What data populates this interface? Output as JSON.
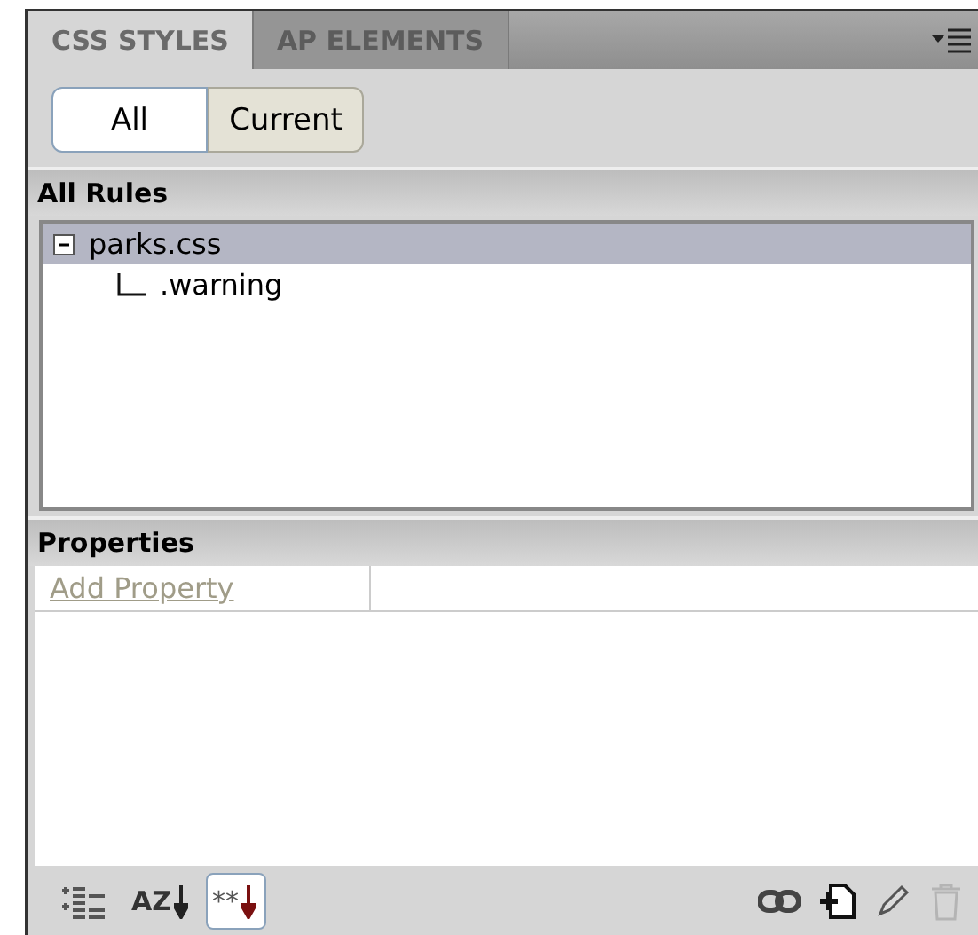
{
  "tabs": [
    {
      "label": "CSS STYLES",
      "selected": true
    },
    {
      "label": "AP ELEMENTS",
      "selected": false
    }
  ],
  "mode_toggle": [
    {
      "label": "All",
      "selected": true
    },
    {
      "label": "Current",
      "selected": false
    }
  ],
  "rules_section": {
    "title": "All Rules",
    "tree": [
      {
        "label": "parks.css",
        "expanded": true,
        "selected": true,
        "children": [
          {
            "label": ".warning",
            "selected": false
          }
        ]
      }
    ]
  },
  "properties_section": {
    "title": "Properties",
    "add_link": "Add Property"
  },
  "view_buttons": [
    {
      "kind": "category",
      "selected": false
    },
    {
      "kind": "alpha",
      "text": "AZ",
      "selected": false
    },
    {
      "kind": "set",
      "text": "**",
      "selected": true
    }
  ],
  "action_buttons": [
    {
      "kind": "attach",
      "disabled": false
    },
    {
      "kind": "new",
      "disabled": false
    },
    {
      "kind": "edit",
      "disabled": false
    },
    {
      "kind": "delete",
      "disabled": true
    }
  ]
}
